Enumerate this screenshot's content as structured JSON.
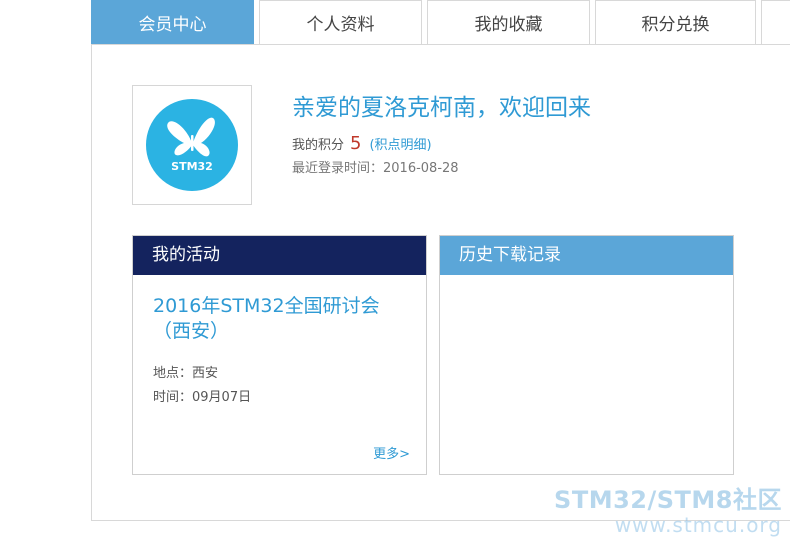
{
  "tabs": [
    {
      "label": "会员中心",
      "active": true
    },
    {
      "label": "个人资料"
    },
    {
      "label": "我的收藏"
    },
    {
      "label": "积分兑换"
    }
  ],
  "profile": {
    "avatar_text": "STM32",
    "welcome": "亲爱的夏洛克柯南，欢迎回来",
    "points_label": "我的积分",
    "points_value": "5",
    "points_link": "(积点明细)",
    "last_login": "最近登录时间：2016-08-28"
  },
  "activity": {
    "header": "我的活动",
    "event_title": "2016年STM32全国研讨会（西安）",
    "place": "地点：西安",
    "time": "时间：09月07日",
    "more": "更多>"
  },
  "history": {
    "header": "历史下载记录"
  },
  "watermark": {
    "line1": "STM32/STM8社区",
    "line2": "www.stmcu.org"
  },
  "colors": {
    "accent": "#5ba6d8",
    "dark_header": "#14235e",
    "link": "#2f9ad4",
    "points": "#c0392b"
  }
}
